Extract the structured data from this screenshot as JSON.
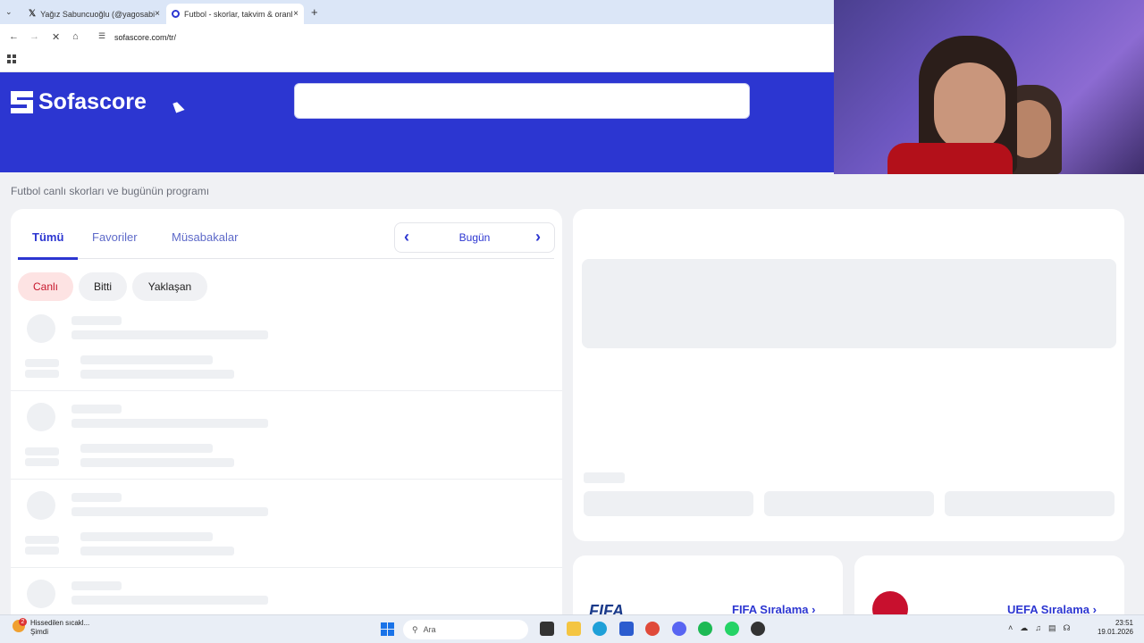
{
  "browser": {
    "tabs": [
      {
        "title": "Yağız Sabuncuoğlu (@yagosabi",
        "favicon": "x-icon"
      },
      {
        "title": "Futbol - skorlar, takvim & oranl",
        "favicon": "sofascore-icon"
      }
    ],
    "new_tab": "+",
    "close": "×",
    "url": "sofascore.com/tr/"
  },
  "site": {
    "logo_text": "Sofascore",
    "search_placeholder": "",
    "subtitle": "Futbol canlı skorları ve bugünün programı",
    "tabs": [
      "Tümü",
      "Favoriler",
      "Müsabakalar"
    ],
    "date_label": "Bugün",
    "filters": [
      "Canlı",
      "Bitti",
      "Yaklaşan"
    ],
    "rankings": [
      {
        "logo": "FIFA",
        "label": "FIFA Sıralama"
      },
      {
        "logo": "",
        "label": "UEFA Sıralama"
      }
    ]
  },
  "taskbar": {
    "weather_line1": "Hissedilen sıcakl...",
    "weather_line2": "Şimdi",
    "search_text": "Ara",
    "time": "23:51",
    "date": "19.01.2026",
    "notification_count": "2"
  },
  "colors": {
    "brand": "#2c36d1",
    "live": "#c7162b"
  }
}
